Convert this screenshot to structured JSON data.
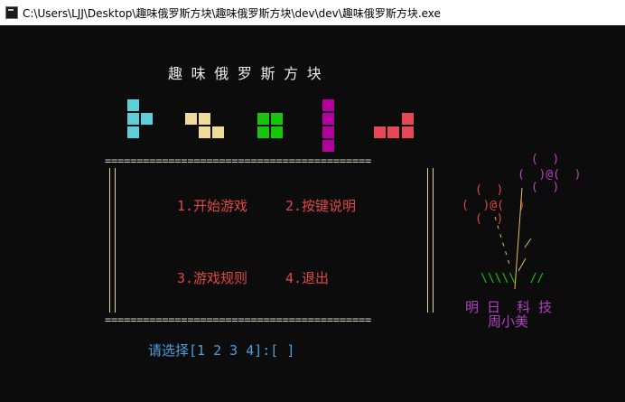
{
  "window": {
    "title": "C:\\Users\\LJJ\\Desktop\\趣味俄罗斯方块\\趣味俄罗斯方块\\dev\\dev\\趣味俄罗斯方块.exe"
  },
  "game": {
    "title": "趣 味 俄 罗 斯 方 块",
    "menu": {
      "start": "1.开始游戏",
      "keys": "2.按键说明",
      "rules": "3.游戏规则",
      "exit": "4.退出"
    },
    "prompt": "请选择[1 2 3 4]:[ ]",
    "border_rule": "=========================================="
  },
  "decoration": {
    "flower_big_top": "(  )",
    "flower_big_mid": "(  )@(  )",
    "flower_big_bot": "(  )",
    "flower_small_top": "(  )",
    "flower_small_mid": "(  )@(  )",
    "flower_small_bot": "(  )",
    "grass": "\\\\\\\\\\  //",
    "company": "明 日  科 技",
    "author": "周小美"
  },
  "colors": {
    "cyan": "#5ccfd8",
    "yellow": "#f0dc9a",
    "green": "#16c60c",
    "purple": "#b4009e",
    "red": "#e74856",
    "menu_red": "#e04848",
    "prompt_blue": "#4a9fe0",
    "flower_magenta": "#c040c0",
    "flower_red": "#e04848",
    "stem_yellow": "#e0c060",
    "grass_green": "#16c60c",
    "author_purple": "#b040c0"
  }
}
